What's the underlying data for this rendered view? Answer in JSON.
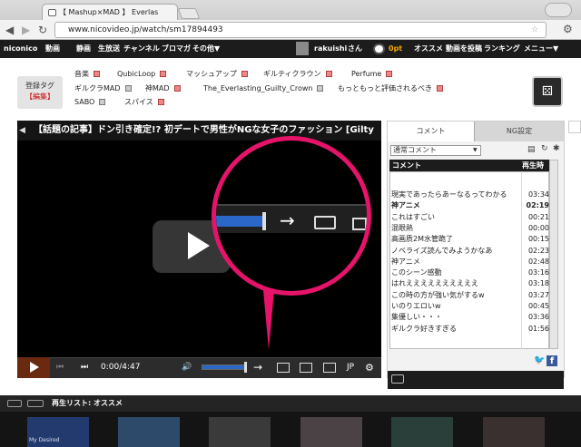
{
  "browser": {
    "tab_title": "【 Mashup×MAD 】 Everlas",
    "tab_close": "✕",
    "url": "www.nicovideo.jp/watch/sm17894493",
    "back_icon": "arrow-left-icon",
    "forward_icon": "arrow-right-icon",
    "reload_icon": "reload-icon",
    "star_icon": "star-icon",
    "menu_icon": "wrench-icon"
  },
  "site_header": {
    "nav_items": [
      "niconico",
      "動画",
      "静画",
      "生放送",
      "チャンネル",
      "ブロマガ",
      "その他▼"
    ],
    "user_name": "rakuishi",
    "user_suffix": "さん",
    "points_count": "0",
    "points_label": "0pt",
    "right_items": [
      "オススメ",
      "動画を投稿",
      "ランキング",
      "メニュー▼"
    ]
  },
  "tags": {
    "box_label": "登録タグ",
    "edit_label": "【編集】",
    "row1": [
      "音楽",
      "QubicLoop",
      "マッシュアップ",
      "ギルティクラウン",
      "Perfume"
    ],
    "row2": [
      "ギルクラMAD",
      "神MAD",
      "The_Everlasting_Guilty_Crown",
      "もっともっと評価されるべき"
    ],
    "row3": [
      "SABO",
      "スパイス"
    ]
  },
  "player": {
    "news_text": "【話題の記事】ドン引き確定!? 初デートで男性がNGな女子のファッション [Gilty",
    "time": "0:00/4:47",
    "lang": "JP",
    "accent": "#e6136b",
    "volume_level": 0.8
  },
  "comment_panel": {
    "tab_comment": "コメント",
    "tab_ng": "NG設定",
    "selector": "通常コメント",
    "col_comment": "コメント",
    "col_time": "再生時",
    "rows": [
      {
        "text": "現実であったらあーなるってわかる",
        "time": "03:34",
        "bold": false
      },
      {
        "text": "神アニメ",
        "time": "02:19",
        "bold": true
      },
      {
        "text": "これはすごい",
        "time": "00:21",
        "bold": false
      },
      {
        "text": "混眼熱",
        "time": "00:00",
        "bold": false
      },
      {
        "text": "高画质2M水管跪了",
        "time": "00:15",
        "bold": false
      },
      {
        "text": "ノベライズ読んでみようかなあ",
        "time": "02:23",
        "bold": false
      },
      {
        "text": "神アニメ",
        "time": "02:48",
        "bold": false
      },
      {
        "text": "このシーン感動",
        "time": "03:16",
        "bold": false
      },
      {
        "text": "はれええええええええええ",
        "time": "03:18",
        "bold": false
      },
      {
        "text": "この時の方が強い気がするw",
        "time": "03:27",
        "bold": false
      },
      {
        "text": "いのりエロいw",
        "time": "00:45",
        "bold": false
      },
      {
        "text": "集優しい・・・",
        "time": "03:36",
        "bold": false
      },
      {
        "text": "ギルクラ好きすぎる",
        "time": "01:56",
        "bold": false
      }
    ]
  },
  "playlist": {
    "label": "再生リスト: オススメ",
    "thumb1_caption": "My Desired"
  }
}
